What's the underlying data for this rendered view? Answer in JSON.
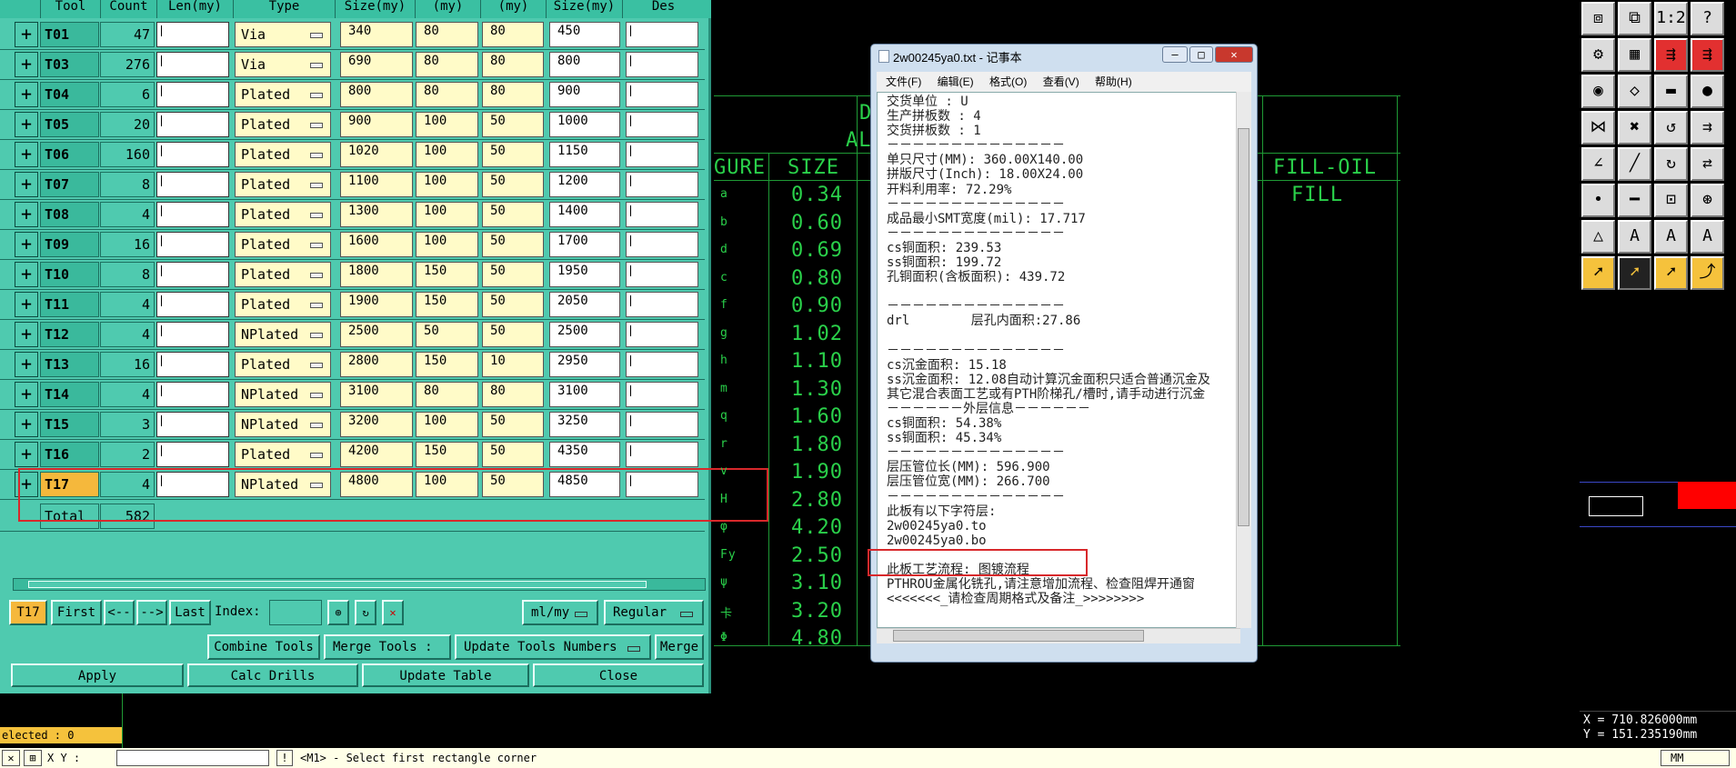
{
  "tool_table": {
    "headers": [
      "Tool",
      "Count",
      "Len(my)",
      "Type",
      "Size(my)",
      "(my)",
      "(my)",
      "Size(my)",
      "Des"
    ],
    "rows": [
      {
        "tool": "T01",
        "count": "47",
        "type": "Via",
        "s1": "340",
        "s2": "80",
        "s3": "80",
        "s4": "450"
      },
      {
        "tool": "T03",
        "count": "276",
        "type": "Via",
        "s1": "690",
        "s2": "80",
        "s3": "80",
        "s4": "800"
      },
      {
        "tool": "T04",
        "count": "6",
        "type": "Plated",
        "s1": "800",
        "s2": "80",
        "s3": "80",
        "s4": "900"
      },
      {
        "tool": "T05",
        "count": "20",
        "type": "Plated",
        "s1": "900",
        "s2": "100",
        "s3": "50",
        "s4": "1000"
      },
      {
        "tool": "T06",
        "count": "160",
        "type": "Plated",
        "s1": "1020",
        "s2": "100",
        "s3": "50",
        "s4": "1150"
      },
      {
        "tool": "T07",
        "count": "8",
        "type": "Plated",
        "s1": "1100",
        "s2": "100",
        "s3": "50",
        "s4": "1200"
      },
      {
        "tool": "T08",
        "count": "4",
        "type": "Plated",
        "s1": "1300",
        "s2": "100",
        "s3": "50",
        "s4": "1400"
      },
      {
        "tool": "T09",
        "count": "16",
        "type": "Plated",
        "s1": "1600",
        "s2": "100",
        "s3": "50",
        "s4": "1700"
      },
      {
        "tool": "T10",
        "count": "8",
        "type": "Plated",
        "s1": "1800",
        "s2": "150",
        "s3": "50",
        "s4": "1950"
      },
      {
        "tool": "T11",
        "count": "4",
        "type": "Plated",
        "s1": "1900",
        "s2": "150",
        "s3": "50",
        "s4": "2050"
      },
      {
        "tool": "T12",
        "count": "4",
        "type": "NPlated",
        "s1": "2500",
        "s2": "50",
        "s3": "50",
        "s4": "2500"
      },
      {
        "tool": "T13",
        "count": "16",
        "type": "Plated",
        "s1": "2800",
        "s2": "150",
        "s3": "10",
        "s4": "2950"
      },
      {
        "tool": "T14",
        "count": "4",
        "type": "NPlated",
        "s1": "3100",
        "s2": "80",
        "s3": "80",
        "s4": "3100"
      },
      {
        "tool": "T15",
        "count": "3",
        "type": "NPlated",
        "s1": "3200",
        "s2": "100",
        "s3": "50",
        "s4": "3250"
      },
      {
        "tool": "T16",
        "count": "2",
        "type": "Plated",
        "s1": "4200",
        "s2": "150",
        "s3": "50",
        "s4": "4350"
      },
      {
        "tool": "T17",
        "count": "4",
        "type": "NPlated",
        "s1": "4800",
        "s2": "100",
        "s3": "50",
        "s4": "4850"
      }
    ],
    "total_label": "Total",
    "total_value": "582"
  },
  "nav": {
    "current": "T17",
    "first": "First",
    "prev": "<--",
    "next": "-->",
    "last": "Last",
    "index_label": "Index:",
    "units": "ml/my",
    "mode": "Regular"
  },
  "actions1": {
    "combine": "Combine Tools",
    "merge_tools": "Merge Tools :",
    "update_numbers": "Update Tools Numbers",
    "merge": "Merge"
  },
  "actions2": {
    "apply": "Apply",
    "calc": "Calc Drills",
    "update": "Update Table",
    "close": "Close"
  },
  "selected": "elected : 0",
  "cad": {
    "header_d": "D",
    "header_al": "AL",
    "col_figure": "GURE",
    "col_size": "SIZE",
    "col_fill": "FILL-OIL",
    "col_fill2": "FILL",
    "sizes": [
      "0.34",
      "0.60",
      "0.69",
      "0.80",
      "0.90",
      "1.02",
      "1.10",
      "1.30",
      "1.60",
      "1.80",
      "1.90",
      "2.80",
      "4.20",
      "2.50",
      "3.10",
      "3.20",
      "4.80"
    ],
    "symbols": [
      "a",
      "b",
      "d",
      "c",
      "f",
      "g",
      "h",
      "m",
      "q",
      "r",
      "v",
      "H",
      "φ",
      "Fy",
      "ψ",
      "卡",
      "Φ"
    ]
  },
  "notepad": {
    "title": "2w00245ya0.txt - 记事本",
    "menu": [
      "文件(F)",
      "编辑(E)",
      "格式(O)",
      "查看(V)",
      "帮助(H)"
    ],
    "lines": [
      "交货单位 : U",
      "生产拼板数 : 4",
      "交货拼板数 : 1",
      "－－－－－－－－－－－－－－",
      "单只尺寸(MM): 360.00X140.00",
      "拼版尺寸(Inch): 18.00X24.00",
      "开料利用率: 72.29%",
      "－－－－－－－－－－－－－－",
      "成品最小SMT宽度(mil): 17.717",
      "－－－－－－－－－－－－－－",
      "cs铜面积: 239.53",
      "ss铜面积: 199.72",
      "孔铜面积(含板面积): 439.72",
      "",
      "－－－－－－－－－－－－－－",
      "drl        层孔内面积:27.86",
      "",
      "－－－－－－－－－－－－－－",
      "cs沉金面积: 15.18",
      "ss沉金面积: 12.08自动计算沉金面积只适合普通沉金及",
      "其它混合表面工艺或有PTH阶梯孔/槽时,请手动进行沉金",
      "－－－－－－外层信息－－－－－－",
      "cs铜面积: 54.38%",
      "ss铜面积: 45.34%",
      "－－－－－－－－－－－－－－",
      "层压管位长(MM): 596.900",
      "层压管位宽(MM): 266.700",
      "－－－－－－－－－－－－－－",
      "此板有以下字符层:",
      "2w00245ya0.to",
      "2w00245ya0.bo",
      "",
      "此板工艺流程: 图镀流程",
      "PTHROU金属化铣孔,请注意增加流程、检查阻焊开通窗",
      "<<<<<<<_请检查周期格式及备注_>>>>>>>>"
    ]
  },
  "coords": {
    "x": "X = 710.826000mm",
    "y": "Y = 151.235190mm"
  },
  "status": {
    "xy_label": "X Y :",
    "message": "<M1> - Select first rectangle corner",
    "unit": "MM"
  }
}
